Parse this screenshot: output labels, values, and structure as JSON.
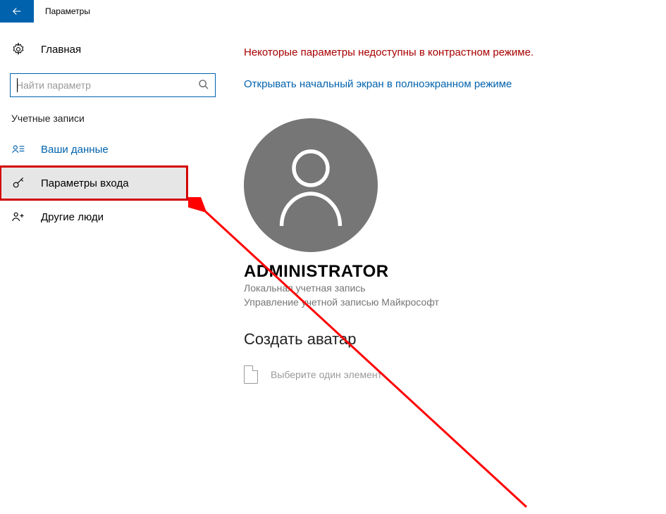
{
  "titlebar": {
    "title": "Параметры"
  },
  "sidebar": {
    "home": "Главная",
    "search_placeholder": "Найти параметр",
    "category": "Учетные записи",
    "items": [
      {
        "label": "Ваши данные"
      },
      {
        "label": "Параметры входа"
      },
      {
        "label": "Другие люди"
      }
    ]
  },
  "main": {
    "warning": "Некоторые параметры недоступны в контрастном режиме.",
    "fullscreen_link": "Открывать начальный экран в полноэкранном режиме",
    "username": "ADMINISTRATOR",
    "account_type": "Локальная учетная запись",
    "ms_manage": "Управление учетной записью Майкрософт",
    "create_avatar": "Создать аватар",
    "picker_hint": "Выберите один элемент"
  }
}
